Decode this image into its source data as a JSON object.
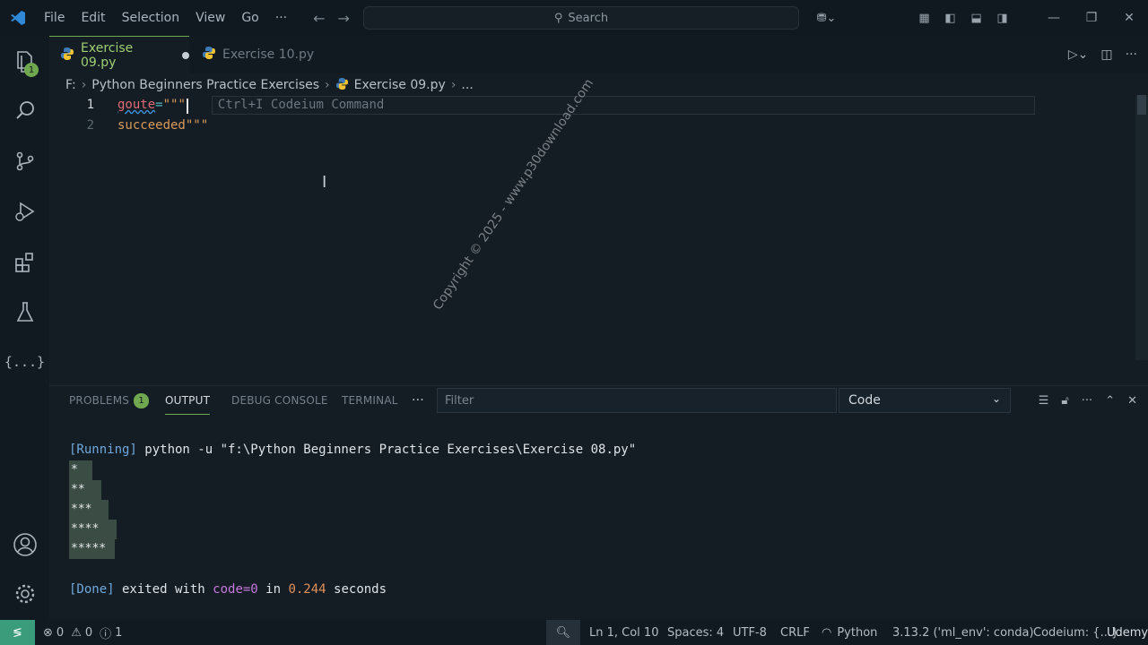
{
  "menu": [
    "File",
    "Edit",
    "Selection",
    "View",
    "Go",
    "···"
  ],
  "search": {
    "label": "Search"
  },
  "activity": {
    "explorer_badge": "1"
  },
  "tabs": [
    {
      "label": "Exercise 09.py",
      "active": true,
      "modified": true
    },
    {
      "label": "Exercise 10.py",
      "active": false
    }
  ],
  "breadcrumb": {
    "drive": "F:",
    "folder": "Python Beginners Practice Exercises",
    "file": "Exercise 09.py",
    "more": "..."
  },
  "editor": {
    "lines": [
      {
        "number": "1",
        "ident": "goute",
        "eq": "=",
        "str": "\"\"\""
      },
      {
        "number": "2",
        "text": "succeeded",
        "str": "\"\"\""
      }
    ],
    "hint": "Ctrl+I Codeium Command"
  },
  "panel": {
    "tabs": [
      "PROBLEMS",
      "OUTPUT",
      "DEBUG CONSOLE",
      "TERMINAL"
    ],
    "problems_badge": "1",
    "more": "···",
    "filter_placeholder": "Filter",
    "select_value": "Code"
  },
  "output": {
    "running_tag": "[Running]",
    "running_cmd": " python -u \"f:\\Python Beginners Practice Exercises\\Exercise 08.py\"",
    "stars": [
      "*",
      "**",
      "***",
      "****",
      "*****"
    ],
    "done_tag": "[Done]",
    "done_text1": " exited with ",
    "done_code": "code=0",
    "done_text2": " in ",
    "done_time": "0.244",
    "done_text3": " seconds"
  },
  "watermark": "Copyright © 2025 - www.p30download.com",
  "status": {
    "errors": "0",
    "warnings": "0",
    "info": "1",
    "position": "Ln 1, Col 10",
    "spaces": "Spaces: 4",
    "encoding": "UTF-8",
    "eol": "CRLF",
    "language": "Python",
    "interpreter": "3.13.2 ('ml_env': conda)",
    "codeium": "Codeium: {...}",
    "udemy": "Udemy"
  },
  "colors": {
    "accent": "#6fa84f",
    "keyword_string": "#d99a5b",
    "running": "#6fa8dc",
    "code": "#c678dd",
    "time": "#e0915a"
  }
}
